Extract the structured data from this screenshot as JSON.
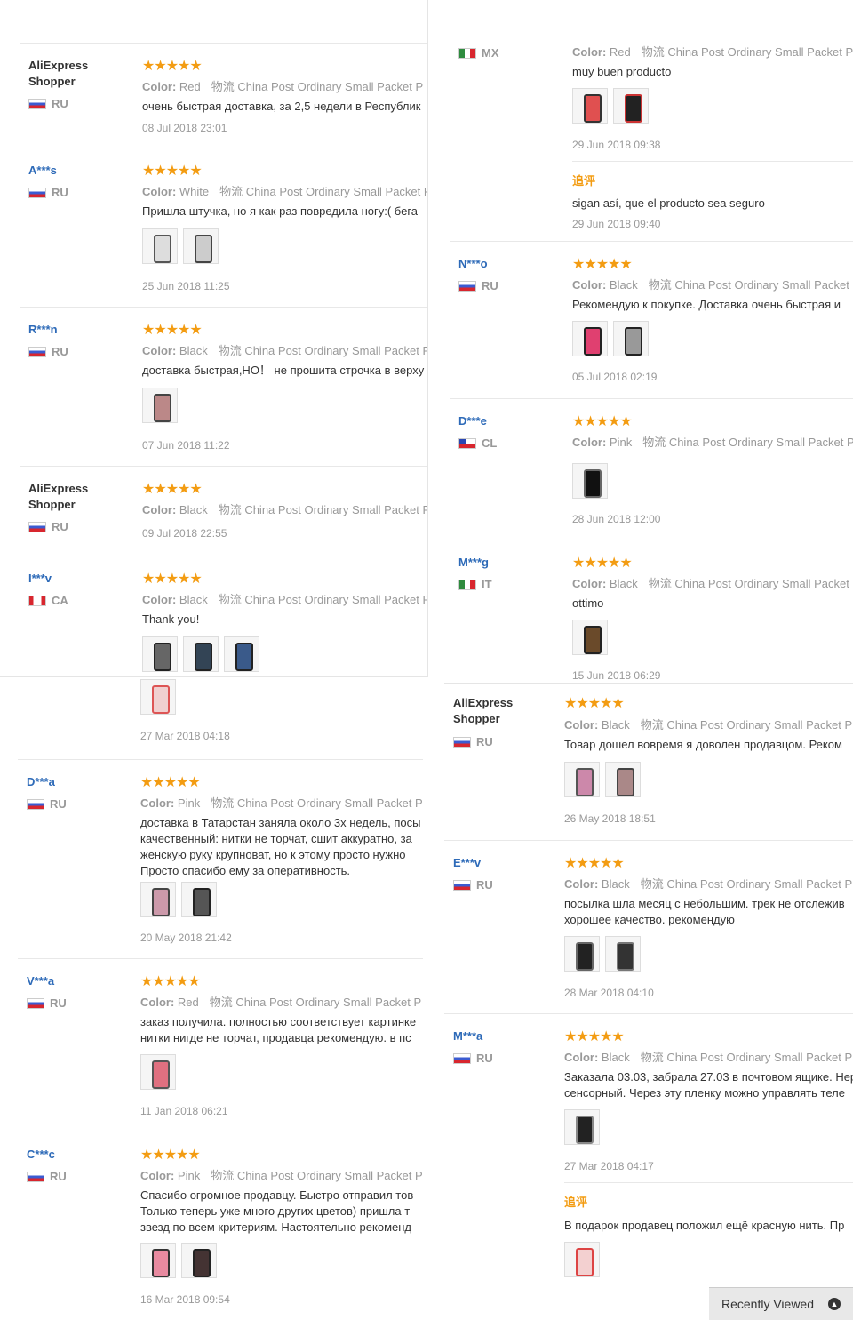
{
  "labels": {
    "color_prefix": "Color:",
    "shipping": "物流 China Post Ordinary Small Packet P",
    "additional_feedback": "追评",
    "recently_viewed": "Recently Viewed"
  },
  "left_column": [
    {
      "user": "AliExpress Shopper",
      "country": "RU",
      "color": "Red",
      "text": "очень быстрая доставка, за 2,5 недели в Республик",
      "date": "08 Jul 2018 23:01"
    },
    {
      "user": "A***s",
      "country": "RU",
      "color": "White",
      "text": "Пришла штучка, но я как раз повредила ногу:( бега",
      "date": "25 Jun 2018 11:25"
    },
    {
      "user": "R***n",
      "country": "RU",
      "color": "Black",
      "text": "доставка быстрая,НО！ не прошита строчка в верху",
      "date": "07 Jun 2018 11:22"
    },
    {
      "user": "AliExpress Shopper",
      "country": "RU",
      "color": "Black",
      "text": "",
      "date": "09 Jul 2018 22:55"
    },
    {
      "user": "I***v",
      "country": "CA",
      "color": "Black",
      "text": "Thank you!",
      "date": "27 Mar 2018 04:18"
    },
    {
      "user": "D***a",
      "country": "RU",
      "color": "Pink",
      "text": "доставка в Татарстан заняла около 3х недель, посы\nкачественный: нитки не торчат, сшит аккуратно, за\nженскую руку крупноват, но к этому просто нужно\nПросто спасибо ему за оперативность.",
      "date": "20 May 2018 21:42"
    },
    {
      "user": "V***a",
      "country": "RU",
      "color": "Red",
      "text": "заказ получила. полностью соответствует картинке\nнитки нигде не торчат, продавца рекомендую. в пс",
      "date": "11 Jan 2018 06:21"
    },
    {
      "user": "C***c",
      "country": "RU",
      "color": "Pink",
      "text": "Спасибо огромное продавцу. Быстро отправил тов\nТолько теперь уже много других цветов) пришла т\nзвезд по всем критериям. Настоятельно рекоменд",
      "date": "16 Mar 2018 09:54"
    }
  ],
  "right_column": [
    {
      "user": "",
      "country": "MX",
      "color": "Red",
      "text": "muy buen producto",
      "date": "29 Jun 2018 09:38",
      "addl_text": "sigan así, que el producto sea seguro",
      "addl_date": "29 Jun 2018 09:40"
    },
    {
      "user": "N***o",
      "country": "RU",
      "color": "Black",
      "text": "Рекомендую к покупке. Доставка очень быстрая и",
      "date": "05 Jul 2018 02:19"
    },
    {
      "user": "D***e",
      "country": "CL",
      "color": "Pink",
      "text": "",
      "date": "28 Jun 2018 12:00"
    },
    {
      "user": "M***g",
      "country": "IT",
      "color": "Black",
      "text": "ottimo",
      "date": "15 Jun 2018 06:29"
    },
    {
      "user": "AliExpress Shopper",
      "country": "RU",
      "color": "Black",
      "text": "Товар дошел вовремя я доволен продавцом. Реком",
      "date": "26 May 2018 18:51"
    },
    {
      "user": "E***v",
      "country": "RU",
      "color": "Black",
      "text": "посылка шла месяц с небольшим. трек не отслежив\nхорошее качество. рекомендую",
      "date": "28 Mar 2018 04:10"
    },
    {
      "user": "M***a",
      "country": "RU",
      "color": "Black",
      "text": "Заказала 03.03, забрала 27.03 в почтовом ящике. Нер\nсенсорный. Через эту пленку можно управлять теле",
      "date": "27 Mar 2018 04:17",
      "addl_text": "В подарок продавец положил ещё красную нить. Пр"
    }
  ],
  "stars": "★★★★★"
}
